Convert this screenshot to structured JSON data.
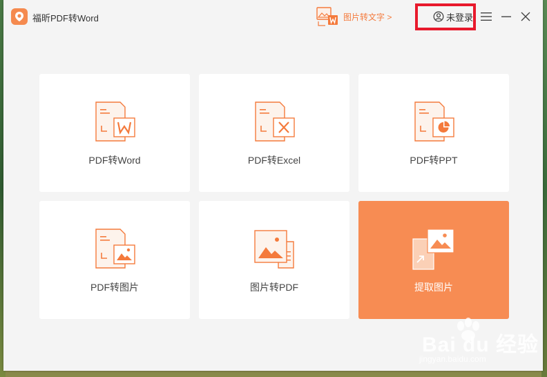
{
  "app": {
    "title": "福昕PDF转Word"
  },
  "header": {
    "image_to_text_label": "图片转文字 >",
    "login_label": "未登录"
  },
  "colors": {
    "accent": "#f78c53",
    "link": "#f47a3c",
    "highlight_box": "#e8192c"
  },
  "cards": [
    {
      "label": "PDF转Word",
      "icon": "pdf-to-word-icon"
    },
    {
      "label": "PDF转Excel",
      "icon": "pdf-to-excel-icon"
    },
    {
      "label": "PDF转PPT",
      "icon": "pdf-to-ppt-icon"
    },
    {
      "label": "PDF转图片",
      "icon": "pdf-to-image-icon"
    },
    {
      "label": "图片转PDF",
      "icon": "image-to-pdf-icon"
    },
    {
      "label": "提取图片",
      "icon": "extract-image-icon",
      "active": true
    }
  ],
  "watermark": {
    "main": "Bai du 经验",
    "sub": "jingyan.baidu.com"
  }
}
